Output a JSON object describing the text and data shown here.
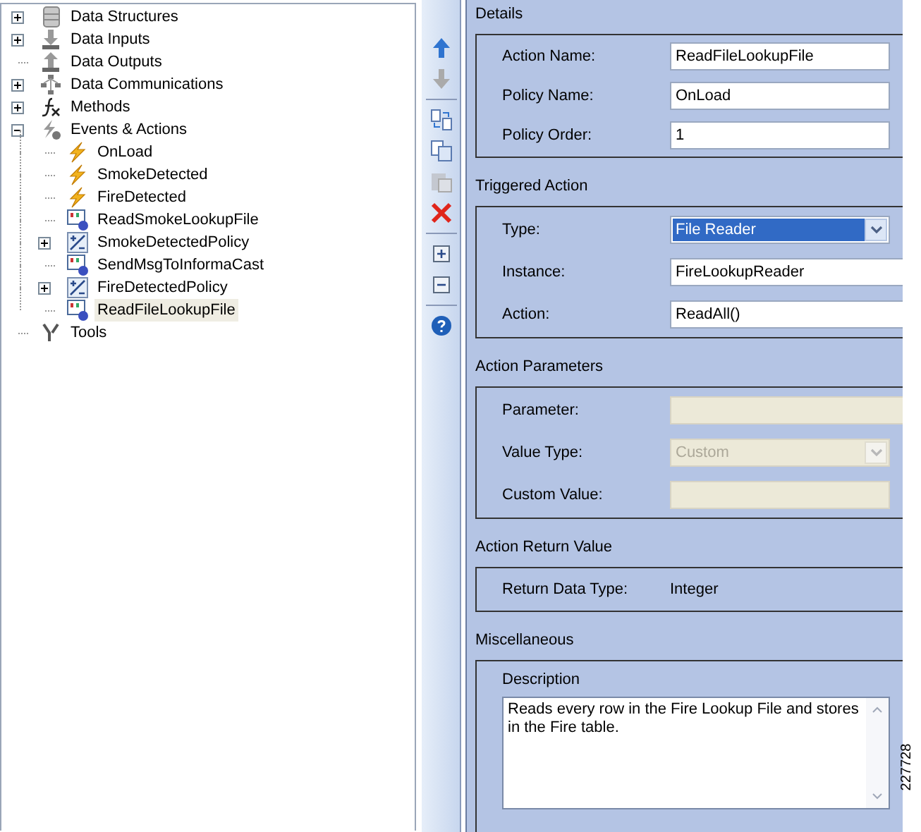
{
  "tree": [
    {
      "label": "Data Structures",
      "kind": "database",
      "expanded": false,
      "selected": false
    },
    {
      "label": "Data Inputs",
      "kind": "input",
      "expanded": false,
      "selected": false
    },
    {
      "label": "Data Outputs",
      "kind": "output",
      "selected": false
    },
    {
      "label": "Data Communications",
      "kind": "network",
      "expanded": false,
      "selected": false
    },
    {
      "label": "Methods",
      "kind": "function",
      "expanded": false,
      "selected": false
    },
    {
      "label": "Events & Actions",
      "kind": "events",
      "expanded": true,
      "selected": false,
      "children": [
        {
          "label": "OnLoad",
          "kind": "lightning",
          "selected": false
        },
        {
          "label": "SmokeDetected",
          "kind": "lightning",
          "selected": false
        },
        {
          "label": "FireDetected",
          "kind": "lightning",
          "selected": false
        },
        {
          "label": "ReadSmokeLookupFile",
          "kind": "action",
          "selected": false
        },
        {
          "label": "SmokeDetectedPolicy",
          "kind": "policy",
          "expanded": false,
          "selected": false
        },
        {
          "label": "SendMsgToInformaCast",
          "kind": "action",
          "selected": false
        },
        {
          "label": "FireDetectedPolicy",
          "kind": "policy",
          "expanded": false,
          "selected": false
        },
        {
          "label": "ReadFileLookupFile",
          "kind": "action",
          "selected": true
        }
      ]
    },
    {
      "label": "Tools",
      "kind": "tools",
      "selected": false
    }
  ],
  "toolbar": [
    [
      {
        "kind": "up",
        "disabled": false
      },
      {
        "kind": "down",
        "disabled": true
      }
    ],
    [
      {
        "kind": "move",
        "disabled": false
      },
      {
        "kind": "copy",
        "disabled": false
      },
      {
        "kind": "paste",
        "disabled": true
      },
      {
        "kind": "delete",
        "disabled": false
      }
    ],
    [
      {
        "kind": "expand",
        "disabled": false
      },
      {
        "kind": "collapse",
        "disabled": false
      }
    ],
    [
      {
        "kind": "help",
        "disabled": false
      }
    ]
  ],
  "sections": [
    {
      "title": "Details",
      "rows": [
        {
          "label": "Action Name:",
          "kind": "text",
          "value": "ReadFileLookupFile",
          "disabled": false
        },
        {
          "label": "Policy Name:",
          "kind": "text",
          "value": "OnLoad",
          "disabled": false
        },
        {
          "label": "Policy Order:",
          "kind": "text",
          "value": "1",
          "disabled": false
        }
      ]
    },
    {
      "title": "Triggered Action",
      "rows": [
        {
          "label": "Type:",
          "kind": "select",
          "value": "File Reader",
          "disabled": false,
          "highlighted": true
        },
        {
          "label": "Instance:",
          "kind": "text",
          "value": "FireLookupReader",
          "disabled": false
        },
        {
          "label": "Action:",
          "kind": "text",
          "value": "ReadAll()",
          "disabled": false
        }
      ]
    },
    {
      "title": "Action Parameters",
      "rows": [
        {
          "label": "Parameter:",
          "kind": "text",
          "disabled": true
        },
        {
          "label": "Value Type:",
          "kind": "select",
          "value": "Custom",
          "disabled": true,
          "highlighted": false
        },
        {
          "label": "Custom Value:",
          "kind": "text",
          "disabled": true
        }
      ]
    },
    {
      "title": "Action Return Value",
      "rows": [
        {
          "label": "Return Data Type:",
          "kind": "static",
          "value": "Integer"
        }
      ]
    },
    {
      "title": "Miscellaneous",
      "rows": [
        {
          "label": "Description",
          "kind": "textarea",
          "value": "Reads every row in the Fire Lookup File and stores in the Fire table."
        }
      ]
    }
  ],
  "figure_number": "227728"
}
